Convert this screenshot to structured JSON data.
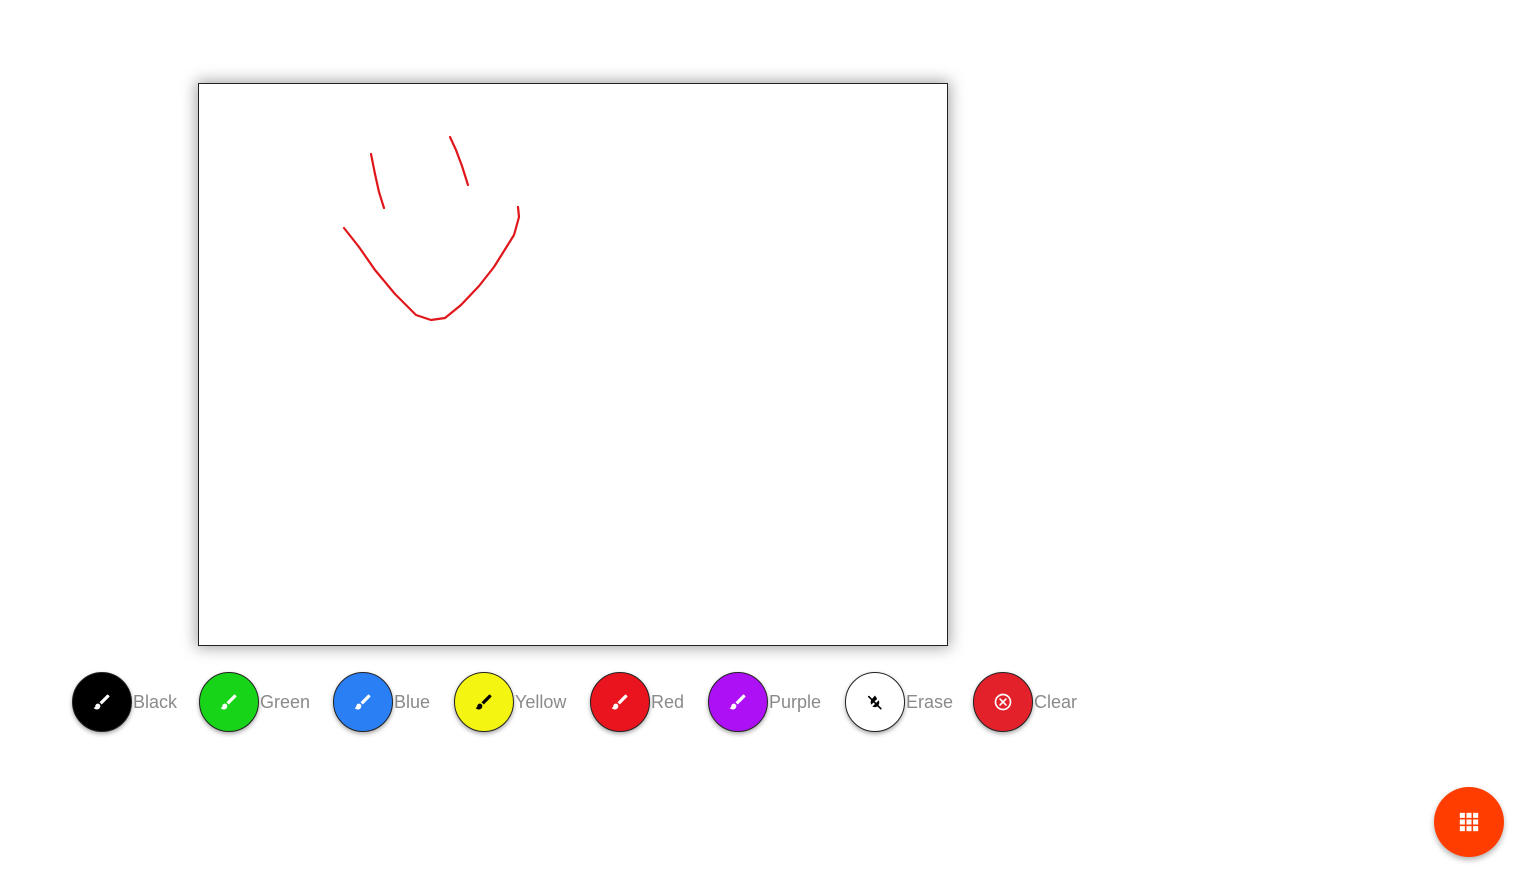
{
  "canvas": {
    "background": "#ffffff",
    "stroke_color": "#e0161b"
  },
  "tools": [
    {
      "label": "Black",
      "color": "#000000",
      "icon": "brush-icon",
      "icon_color": "#ffffff"
    },
    {
      "label": "Green",
      "color": "#17d418",
      "icon": "brush-icon",
      "icon_color": "#ffffff"
    },
    {
      "label": "Blue",
      "color": "#2a7ff5",
      "icon": "brush-icon",
      "icon_color": "#ffffff"
    },
    {
      "label": "Yellow",
      "color": "#f5f512",
      "icon": "brush-icon",
      "icon_color": "#000000"
    },
    {
      "label": "Red",
      "color": "#e9141d",
      "icon": "brush-icon",
      "icon_color": "#ffffff"
    },
    {
      "label": "Purple",
      "color": "#ad10f4",
      "icon": "brush-icon",
      "icon_color": "#ffffff"
    },
    {
      "label": "Erase",
      "color": "#ffffff",
      "icon": "invert-colors-off-icon",
      "icon_color": "#000000"
    },
    {
      "label": "Clear",
      "color": "#e3212b",
      "icon": "cancel-circle-icon",
      "icon_color": "#ffffff"
    }
  ],
  "fab": {
    "color": "#ff3d00",
    "icon": "apps-grid-icon"
  }
}
